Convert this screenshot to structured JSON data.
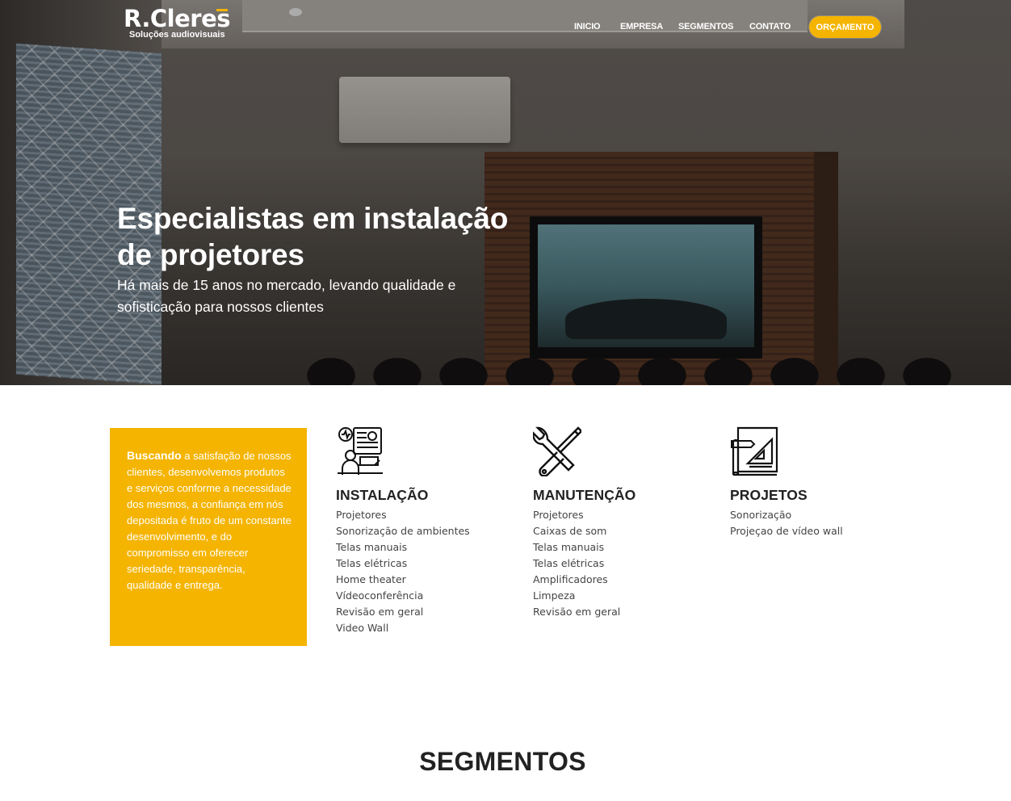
{
  "brand": {
    "name": "R.Cleres",
    "tagline": "Soluções audiovisuais"
  },
  "nav": {
    "items": [
      "INICIO",
      "EMPRESA",
      "SEGMENTOS",
      "CONTATO"
    ],
    "cta": "ORÇAMENTO"
  },
  "hero": {
    "title_line1": "Especialistas em instalação",
    "title_line2": "de projetores",
    "subtitle": "Há mais de 15 anos no mercado, levando qualidade e sofisticação para nossos clientes"
  },
  "about": {
    "lead": "Buscando",
    "text": " a satisfação de nossos clientes, desenvolvemos produtos e serviços conforme a necessidade dos mesmos, a confiança em nós depositada é fruto de um constante desenvolvimento, e do compromisso em oferecer seriedade, transparência, qualidade e entrega."
  },
  "services": [
    {
      "title": "INSTALAÇÃO",
      "icon": "installation-icon",
      "items": [
        "Projetores",
        "Sonorização de ambientes",
        "Telas manuais",
        "Telas elétricas",
        "Home theater",
        "Vídeoconferência",
        "Revisão em geral",
        "Video Wall"
      ]
    },
    {
      "title": "MANUTENÇÃO",
      "icon": "tools-icon",
      "items": [
        "Projetores",
        "Caixas de som",
        "Telas manuais",
        "Telas elétricas",
        "Amplificadores",
        "Limpeza",
        "Revisão em geral"
      ]
    },
    {
      "title": "PROJETOS",
      "icon": "blueprint-icon",
      "items": [
        "Sonorização",
        "Projeçao de vídeo wall"
      ]
    }
  ],
  "segments": {
    "title": "SEGMENTOS"
  },
  "colors": {
    "accent": "#f4b400",
    "text": "#222222"
  }
}
